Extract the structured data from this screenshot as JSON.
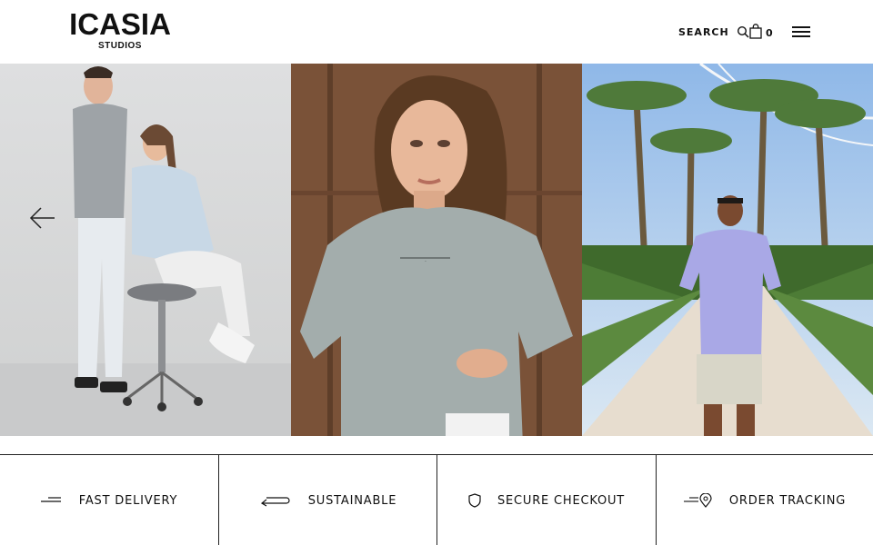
{
  "header": {
    "logo_main": "ICASIA",
    "logo_sub": "STUDIOS",
    "search_label": "SEARCH",
    "cart_count": "0"
  },
  "icons": {
    "search": "search-icon",
    "cart": "shopping-bag-icon",
    "menu": "hamburger-menu-icon",
    "prev": "arrow-left-icon"
  },
  "hero": {
    "slides": [
      {
        "description_icon": "photo-couple-grey-outfits"
      },
      {
        "description_icon": "photo-woman-grey-tshirt"
      },
      {
        "description_icon": "photo-man-lavender-tshirt-palms"
      }
    ]
  },
  "features": [
    {
      "label": "FAST DELIVERY",
      "icon": "delivery-lines-icon"
    },
    {
      "label": "SUSTAINABLE",
      "icon": "return-arrow-icon"
    },
    {
      "label": "SECURE CHECKOUT",
      "icon": "shield-icon"
    },
    {
      "label": "ORDER TRACKING",
      "icon": "location-pin-icon"
    }
  ],
  "colors": {
    "text": "#111111",
    "background": "#ffffff",
    "divider": "#222222"
  }
}
